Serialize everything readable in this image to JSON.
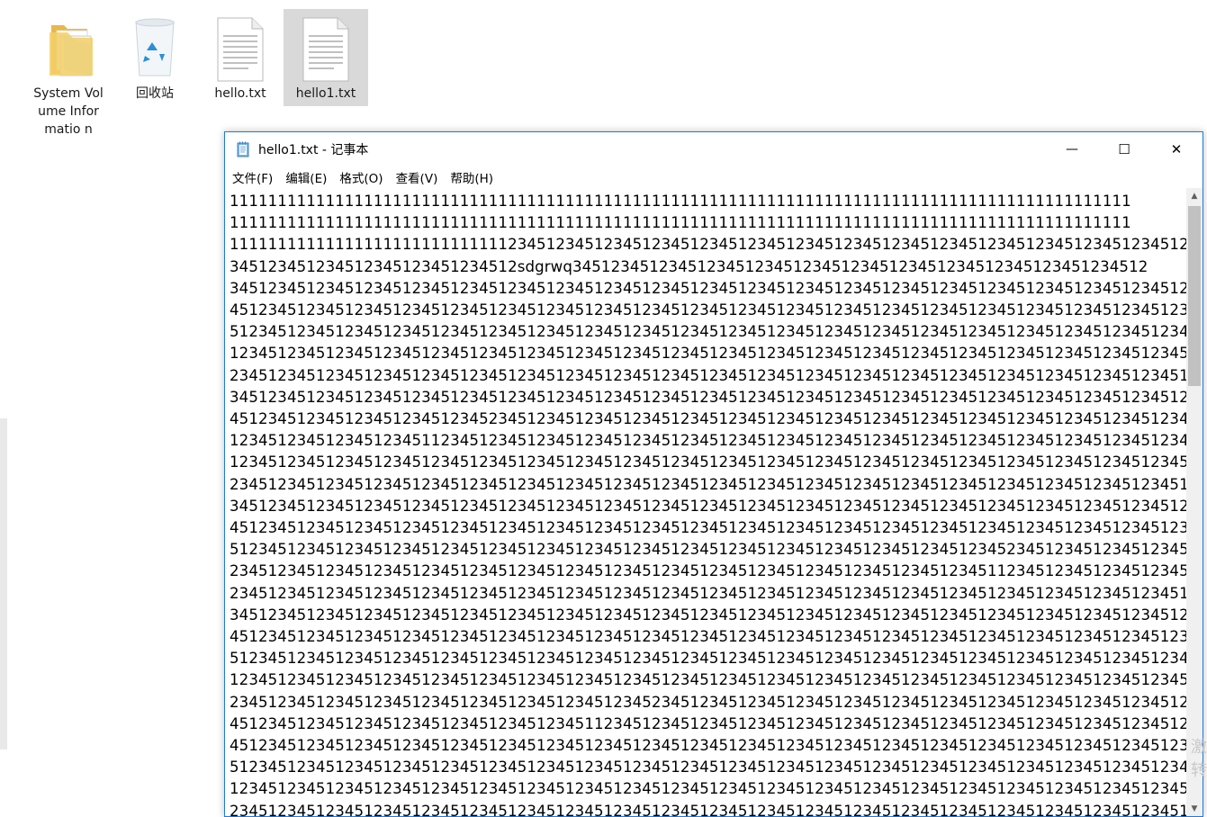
{
  "desktop": {
    "icons": [
      {
        "label": "System Volume Informatio n",
        "icon": "folder-icon"
      },
      {
        "label": "回收站",
        "icon": "recycle-bin-icon"
      },
      {
        "label": "hello.txt",
        "icon": "text-file-icon"
      },
      {
        "label": "hello1.txt",
        "icon": "text-file-icon",
        "selected": true
      }
    ]
  },
  "window": {
    "title": "hello1.txt - 记事本",
    "controls": {
      "minimize": "—",
      "maximize": "☐",
      "close": "✕"
    },
    "menu": [
      "文件(F)",
      "编辑(E)",
      "格式(O)",
      "查看(V)",
      "帮助(H)"
    ],
    "lines": [
      "1111111111111111111111111111111111111111111111111111111111111111111111111111111111111111111111",
      "1111111111111111111111111111111111111111111111111111111111111111111111111111111111111111111111",
      "1111111111111111111111111111123451234512345123451234512345123451234512345123451234512345123451234512",
      "345123451234512345123451234512sdgrwq345123451234512345123451234512345123451234512345123451234512",
      "3451234512345123451234512345123451234512345123451234512345123451234512345123451234512345123451234512345123",
      "4512345123451234512345123451234512345123451234512345123451234512345123451234512345123451234512345123451234",
      "5123451234512345123451234512345123451234512345123451234512345123451234512345123451234512345123451234512345",
      "1234512345123451234512345123451234512345123451234512345123451234512345123451234512345123451234512345123451",
      "2345123451234512345123451234512345123451234512345123451234512345123451234512345123451234512345123451234512",
      "3451234512345123451234512345123451234512345123451234512345123451234512345123451234512345123451234512345123",
      "4512345123451234512345123452345123451234512345123451234512345123451234512345123451234512345123451234512345",
      "1234512345123451234511234512345123451234512345123451234512345123451234512345123451234512345123451234512345",
      "1234512345123451234512345123451234512345123451234512345123451234512345123451234512345123451234512345123451",
      "2345123451234512345123451234512345123451234512345123451234512345123451234512345123451234512345123451234512",
      "3451234512345123451234512345123451234512345123451234512345123451234512345123451234512345123451234512345123",
      "4512345123451234512345123451234512345123451234512345123451234512345123451234512345123451234512345123451234",
      "5123451234512345123451234512345123451234512345123451234512345123451234512345123452345123451234512345123451",
      "2345123451234512345123451234512345123451234512345123451234512345123451234512345112345123451234512345123451",
      "2345123451234512345123451234512345123451234512345123451234512345123451234512345123451234512345123451234512",
      "3451234512345123451234512345123451234512345123451234512345123451234512345123451234512345123451234512345123",
      "4512345123451234512345123451234512345123451234512345123451234512345123451234512345123451234512345123451234",
      "5123451234512345123451234512345123451234512345123451234512345123451234512345123451234512345123451234512345",
      "1234512345123451234512345123451234512345123451234512345123451234512345123451234512345123451234512345123451",
      "2345123451234512345123451234512345123451234523451234512345123451234512345123451234512345123451234512345123",
      "4512345123451234512345123451234512345112345123451234512345123451234512345123451234512345123451234512345123",
      "4512345123451234512345123451234512345123451234512345123451234512345123451234512345123451234512345123451234",
      "5123451234512345123451234512345123451234512345123451234512345123451234512345123451234512345123451234512345",
      "1234512345123451234512345123451234512345123451234512345123451234512345123451234512345123451234512345123451",
      "2345123451234512345123451234512345123451234512345123451234512345123451234512345123451234512345123451234512"
    ]
  },
  "watermark": {
    "text": "激 转"
  },
  "colors": {
    "accent": "#1f7ad9",
    "selection": "#d9d9d9",
    "scrollbar": "#c1c1c1"
  }
}
